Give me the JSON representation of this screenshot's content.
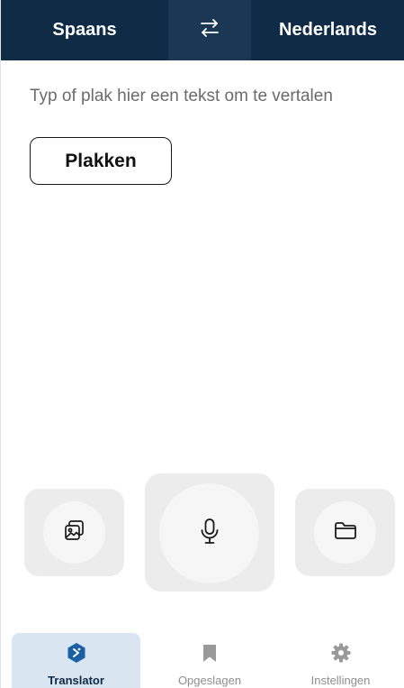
{
  "header": {
    "source_language": "Spaans",
    "target_language": "Nederlands",
    "swap_icon": "swap-arrows-icon"
  },
  "input": {
    "placeholder": "Typ of plak hier een tekst om te vertalen",
    "paste_label": "Plakken"
  },
  "actions": {
    "image_icon": "image-gallery-icon",
    "mic_icon": "microphone-icon",
    "document_icon": "folder-icon"
  },
  "nav": {
    "items": [
      {
        "label": "Translator",
        "icon": "translator-logo-icon",
        "active": true
      },
      {
        "label": "Opgeslagen",
        "icon": "bookmark-icon",
        "active": false
      },
      {
        "label": "Instellingen",
        "icon": "gear-icon",
        "active": false
      }
    ]
  },
  "colors": {
    "header_bg": "#0f2b46",
    "active_nav_bg": "#d9e6f2",
    "tile_bg": "#ececec"
  }
}
